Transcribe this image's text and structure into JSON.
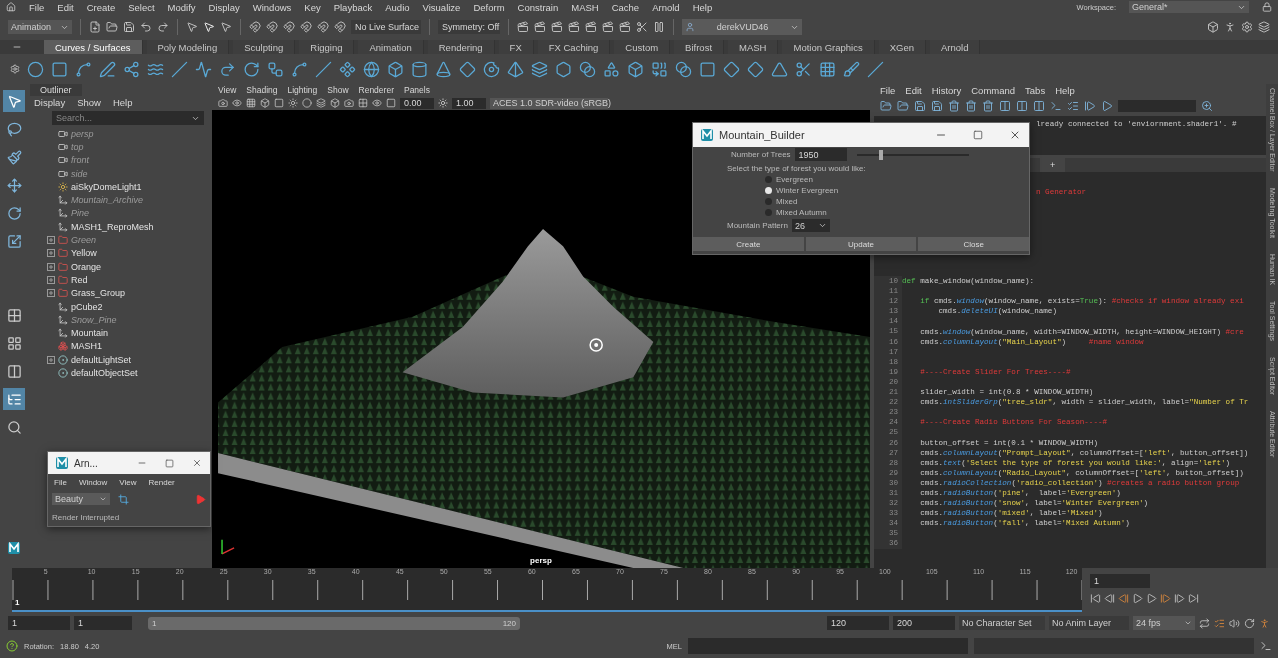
{
  "menu_bar": {
    "items": [
      "File",
      "Edit",
      "Create",
      "Select",
      "Modify",
      "Display",
      "Windows",
      "Key",
      "Playback",
      "Audio",
      "Visualize",
      "Deform",
      "Constrain",
      "MASH",
      "Cache",
      "Arnold",
      "Help"
    ],
    "workspace_label": "Workspace:",
    "workspace": "General*"
  },
  "status_line": {
    "mode": "Animation",
    "live_surface": "No Live Surface",
    "symmetry": "Symmetry: Off",
    "user": "derekVUD46"
  },
  "shelf": {
    "tabs": [
      {
        "label": "Curves / Surfaces",
        "selected": true
      },
      {
        "label": "Poly Modeling",
        "selected": false
      },
      {
        "label": "Sculpting",
        "selected": false
      },
      {
        "label": "Rigging",
        "selected": false
      },
      {
        "label": "Animation",
        "selected": false
      },
      {
        "label": "Rendering",
        "selected": false
      },
      {
        "label": "FX",
        "selected": false
      },
      {
        "label": "FX Caching",
        "selected": false
      },
      {
        "label": "Custom",
        "selected": false
      },
      {
        "label": "Bifrost",
        "selected": false
      },
      {
        "label": "MASH",
        "selected": false
      },
      {
        "label": "Motion Graphics",
        "selected": false
      },
      {
        "label": "XGen",
        "selected": false
      },
      {
        "label": "Arnold",
        "selected": false
      }
    ]
  },
  "outliner": {
    "title": "Outliner",
    "menus": [
      "Display",
      "Show",
      "Help"
    ],
    "search": {
      "placeholder": "Search..."
    },
    "items": [
      {
        "label": "persp",
        "kind": "camera",
        "hidden": true,
        "expandable": false
      },
      {
        "label": "top",
        "kind": "camera",
        "hidden": true,
        "expandable": false
      },
      {
        "label": "front",
        "kind": "camera",
        "hidden": true,
        "expandable": false
      },
      {
        "label": "side",
        "kind": "camera",
        "hidden": true,
        "expandable": false
      },
      {
        "label": "aiSkyDomeLight1",
        "kind": "light",
        "hidden": false,
        "expandable": false
      },
      {
        "label": "Mountain_Archive",
        "kind": "transform",
        "hidden": true,
        "expandable": false
      },
      {
        "label": "Pine",
        "kind": "transform",
        "hidden": true,
        "expandable": false
      },
      {
        "label": "MASH1_ReproMesh",
        "kind": "transform",
        "hidden": false,
        "expandable": false
      },
      {
        "label": "Green",
        "kind": "group",
        "hidden": true,
        "expandable": true
      },
      {
        "label": "Yellow",
        "kind": "group",
        "hidden": false,
        "expandable": true
      },
      {
        "label": "Orange",
        "kind": "group",
        "hidden": false,
        "expandable": true
      },
      {
        "label": "Red",
        "kind": "group",
        "hidden": false,
        "expandable": true
      },
      {
        "label": "Grass_Group",
        "kind": "group",
        "hidden": false,
        "expandable": true
      },
      {
        "label": "pCube2",
        "kind": "transform",
        "hidden": false,
        "expandable": false
      },
      {
        "label": "Snow_Pine",
        "kind": "transform",
        "hidden": true,
        "expandable": false
      },
      {
        "label": "Mountain",
        "kind": "transform",
        "hidden": false,
        "expandable": false
      },
      {
        "label": "MASH1",
        "kind": "mash",
        "hidden": false,
        "expandable": false
      },
      {
        "label": "defaultLightSet",
        "kind": "set",
        "hidden": false,
        "expandable": true
      },
      {
        "label": "defaultObjectSet",
        "kind": "set",
        "hidden": false,
        "expandable": false
      }
    ]
  },
  "viewport": {
    "menus": [
      "View",
      "Shading",
      "Lighting",
      "Show",
      "Renderer",
      "Panels"
    ],
    "exposure": "0.00",
    "gamma": "1.00",
    "color_space": "ACES 1.0 SDR-video (sRGB)",
    "camera_label": "persp"
  },
  "script_editor": {
    "menus": [
      "File",
      "Edit",
      "History",
      "Command",
      "Tabs",
      "Help"
    ],
    "history_line": "lready connected to 'enviornment.shader1'. #",
    "tab_add": "+",
    "fragment": "n Generator",
    "lines": [
      {
        "number": "10",
        "segments": [
          {
            "kind": "keyword",
            "text": "def"
          },
          {
            "kind": "plain",
            "text": " make_window(window_name):"
          }
        ]
      },
      {
        "number": "11"
      },
      {
        "number": "12",
        "segments": [
          {
            "kind": "keyword",
            "text": "    if"
          },
          {
            "kind": "plain",
            "text": " cmds."
          },
          {
            "kind": "function",
            "text": "window"
          },
          {
            "kind": "plain",
            "text": "(window_name, exists="
          },
          {
            "kind": "keyword",
            "text": "True"
          },
          {
            "kind": "plain",
            "text": "): "
          },
          {
            "kind": "comment",
            "text": "#checks if window already exi"
          }
        ]
      },
      {
        "number": "13",
        "segments": [
          {
            "kind": "plain",
            "text": "        cmds."
          },
          {
            "kind": "function",
            "text": "deleteUI"
          },
          {
            "kind": "plain",
            "text": "(window_name)"
          }
        ]
      },
      {
        "number": "14"
      },
      {
        "number": "15",
        "segments": [
          {
            "kind": "plain",
            "text": "    cmds."
          },
          {
            "kind": "function",
            "text": "window"
          },
          {
            "kind": "plain",
            "text": "(window_name, width=WINDOW_WIDTH, height=WINDOW_HEIGHT) "
          },
          {
            "kind": "comment",
            "text": "#cre"
          }
        ]
      },
      {
        "number": "16",
        "segments": [
          {
            "kind": "plain",
            "text": "    cmds."
          },
          {
            "kind": "function",
            "text": "columnLayout"
          },
          {
            "kind": "plain",
            "text": "("
          },
          {
            "kind": "string",
            "text": "\"Main_Layout\""
          },
          {
            "kind": "plain",
            "text": ")     "
          },
          {
            "kind": "comment",
            "text": "#name window"
          }
        ]
      },
      {
        "number": "17"
      },
      {
        "number": "18"
      },
      {
        "number": "19",
        "segments": [
          {
            "kind": "comment",
            "text": "    #----Create Slider For Trees----#"
          }
        ]
      },
      {
        "number": "20"
      },
      {
        "number": "21",
        "segments": [
          {
            "kind": "plain",
            "text": "    slider_width = int(0.8 * WINDOW_WIDTH)"
          }
        ]
      },
      {
        "number": "22",
        "segments": [
          {
            "kind": "plain",
            "text": "    cmds."
          },
          {
            "kind": "function",
            "text": "intSliderGrp"
          },
          {
            "kind": "plain",
            "text": "("
          },
          {
            "kind": "string",
            "text": "\"tree_sldr\""
          },
          {
            "kind": "plain",
            "text": ", width = slider_width, label="
          },
          {
            "kind": "string",
            "text": "\"Number of Tr"
          }
        ]
      },
      {
        "number": "23"
      },
      {
        "number": "24",
        "segments": [
          {
            "kind": "comment",
            "text": "    #----Create Radio Buttons For Season----#"
          }
        ]
      },
      {
        "number": "25"
      },
      {
        "number": "26",
        "segments": [
          {
            "kind": "plain",
            "text": "    button_offset = int(0.1 * WINDOW_WIDTH)"
          }
        ]
      },
      {
        "number": "27",
        "segments": [
          {
            "kind": "plain",
            "text": "    cmds."
          },
          {
            "kind": "function",
            "text": "columnLayout"
          },
          {
            "kind": "plain",
            "text": "("
          },
          {
            "kind": "string",
            "text": "\"Prompt_Layout\""
          },
          {
            "kind": "plain",
            "text": ", columnOffset=["
          },
          {
            "kind": "string",
            "text": "'left'"
          },
          {
            "kind": "plain",
            "text": ", button_offset])"
          }
        ]
      },
      {
        "number": "28",
        "segments": [
          {
            "kind": "plain",
            "text": "    cmds."
          },
          {
            "kind": "function",
            "text": "text"
          },
          {
            "kind": "plain",
            "text": "("
          },
          {
            "kind": "string",
            "text": "'Select the type of forest you would like:'"
          },
          {
            "kind": "plain",
            "text": ", align="
          },
          {
            "kind": "string",
            "text": "'left'"
          },
          {
            "kind": "plain",
            "text": ")"
          }
        ]
      },
      {
        "number": "29",
        "segments": [
          {
            "kind": "plain",
            "text": "    cmds."
          },
          {
            "kind": "function",
            "text": "columnLayout"
          },
          {
            "kind": "plain",
            "text": "("
          },
          {
            "kind": "string",
            "text": "\"Radio_Layout\""
          },
          {
            "kind": "plain",
            "text": ", columnOffset=["
          },
          {
            "kind": "string",
            "text": "'left'"
          },
          {
            "kind": "plain",
            "text": ", button_offset])"
          }
        ]
      },
      {
        "number": "30",
        "segments": [
          {
            "kind": "plain",
            "text": "    cmds."
          },
          {
            "kind": "function",
            "text": "radioCollection"
          },
          {
            "kind": "plain",
            "text": "("
          },
          {
            "kind": "string",
            "text": "'radio_collection'"
          },
          {
            "kind": "plain",
            "text": ") "
          },
          {
            "kind": "comment",
            "text": "#creates a radio button group"
          }
        ]
      },
      {
        "number": "31",
        "segments": [
          {
            "kind": "plain",
            "text": "    cmds."
          },
          {
            "kind": "function",
            "text": "radioButton"
          },
          {
            "kind": "plain",
            "text": "("
          },
          {
            "kind": "string",
            "text": "'pine'"
          },
          {
            "kind": "plain",
            "text": ",  label="
          },
          {
            "kind": "string",
            "text": "'Evergreen'"
          },
          {
            "kind": "plain",
            "text": ")"
          }
        ]
      },
      {
        "number": "32",
        "segments": [
          {
            "kind": "plain",
            "text": "    cmds."
          },
          {
            "kind": "function",
            "text": "radioButton"
          },
          {
            "kind": "plain",
            "text": "("
          },
          {
            "kind": "string",
            "text": "'snow'"
          },
          {
            "kind": "plain",
            "text": ", label="
          },
          {
            "kind": "string",
            "text": "'Winter Evergreen'"
          },
          {
            "kind": "plain",
            "text": ")"
          }
        ]
      },
      {
        "number": "33",
        "segments": [
          {
            "kind": "plain",
            "text": "    cmds."
          },
          {
            "kind": "function",
            "text": "radioButton"
          },
          {
            "kind": "plain",
            "text": "("
          },
          {
            "kind": "string",
            "text": "'mixed'"
          },
          {
            "kind": "plain",
            "text": ", label="
          },
          {
            "kind": "string",
            "text": "'Mixed'"
          },
          {
            "kind": "plain",
            "text": ")"
          }
        ]
      },
      {
        "number": "34",
        "segments": [
          {
            "kind": "plain",
            "text": "    cmds."
          },
          {
            "kind": "function",
            "text": "radioButton"
          },
          {
            "kind": "plain",
            "text": "("
          },
          {
            "kind": "string",
            "text": "'fall'"
          },
          {
            "kind": "plain",
            "text": ", label="
          },
          {
            "kind": "string",
            "text": "'Mixed Autumn'"
          },
          {
            "kind": "plain",
            "text": ")"
          }
        ]
      },
      {
        "number": "35"
      },
      {
        "number": "36"
      }
    ]
  },
  "side_tabs": [
    "Channel Box / Layer Editor",
    "Modeling Toolkit",
    "Human IK",
    "Tool Settings",
    "Script Editor",
    "Attribute Editor"
  ],
  "mountain_builder": {
    "title": "Mountain_Builder",
    "trees_label": "Number of Trees",
    "trees_value": "1950",
    "trees_slider": {
      "level": 0.22
    },
    "prompt": "Select the type of forest you would like:",
    "forest_types": [
      {
        "label": "Evergreen",
        "selected": false
      },
      {
        "label": "Winter Evergreen",
        "selected": true
      },
      {
        "label": "Mixed",
        "selected": false
      },
      {
        "label": "Mixed Autumn",
        "selected": false
      }
    ],
    "pattern_label": "Mountain Pattern",
    "pattern_value": "26",
    "buttons": [
      "Create",
      "Update",
      "Close"
    ]
  },
  "arnold_window": {
    "title": "Arn...",
    "menus": [
      "File",
      "Window",
      "View",
      "Render"
    ],
    "aov": "Beauty",
    "status": "Render Interrupted"
  },
  "timeline": {
    "frame_labels": [
      "5",
      "10",
      "15",
      "20",
      "25",
      "30",
      "35",
      "40",
      "45",
      "50",
      "55",
      "60",
      "65",
      "70",
      "75",
      "80",
      "85",
      "90",
      "95",
      "100",
      "105",
      "110",
      "115",
      "120"
    ],
    "current_frame": "1",
    "frame_field": "1"
  },
  "range": {
    "slider": {
      "level": 1
    },
    "start": "1",
    "playback_start": "1",
    "slider_start": "1",
    "slider_end": "120",
    "playback_end": "120",
    "end": "200",
    "character_set": "No Character Set",
    "anim_layer": "No Anim Layer",
    "fps": "24 fps"
  },
  "command_line": {
    "help_label": "Rotation:",
    "values": [
      "18.80",
      "4.20"
    ],
    "language": "MEL"
  }
}
